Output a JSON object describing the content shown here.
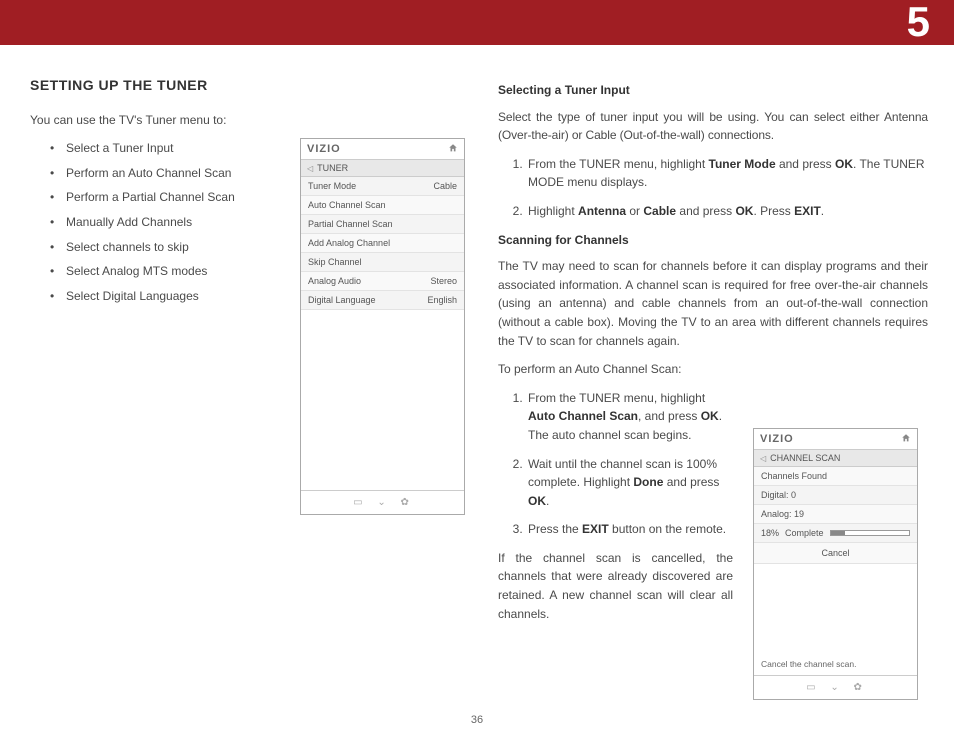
{
  "chapter": "5",
  "pageNumber": "36",
  "left": {
    "title": "SETTING UP THE TUNER",
    "intro": "You can use the TV's Tuner menu to:",
    "bullets": [
      "Select a Tuner Input",
      "Perform an Auto Channel Scan",
      "Perform a Partial Channel Scan",
      "Manually Add Channels",
      "Select channels to skip",
      "Select Analog MTS modes",
      "Select Digital Languages"
    ]
  },
  "osdTuner": {
    "logo": "VIZIO",
    "crumb": "TUNER",
    "rows": [
      {
        "label": "Tuner Mode",
        "value": "Cable"
      },
      {
        "label": "Auto Channel Scan",
        "value": ""
      },
      {
        "label": "Partial Channel Scan",
        "value": ""
      },
      {
        "label": "Add Analog Channel",
        "value": ""
      },
      {
        "label": "Skip Channel",
        "value": ""
      },
      {
        "label": "Analog Audio",
        "value": "Stereo"
      },
      {
        "label": "Digital Language",
        "value": "English"
      }
    ]
  },
  "right": {
    "h1": "Selecting a Tuner Input",
    "p1": "Select the type of tuner input you will be using. You can select either Antenna (Over-the-air) or Cable (Out-of-the-wall) connections.",
    "s1a": "From the TUNER menu, highlight ",
    "s1b": "Tuner Mode",
    "s1c": " and press ",
    "s1d": "OK",
    "s1e": ". The TUNER MODE menu displays.",
    "s2a": "Highlight ",
    "s2b": "Antenna",
    "s2c": " or ",
    "s2d": "Cable",
    "s2e": " and press ",
    "s2f": "OK",
    "s2g": ". Press ",
    "s2h": "EXIT",
    "s2i": ".",
    "h2": "Scanning for Channels",
    "p2": "The TV may need to scan for channels before it can display programs and their associated information. A channel scan is required for free over-the-air channels (using an antenna) and cable channels from an out-of-the-wall connection (without a cable box). Moving the TV to an area with different channels requires the TV to scan for channels again.",
    "p3": "To perform an Auto Channel Scan:",
    "st1a": "From the TUNER menu, highlight ",
    "st1b": "Auto Channel Scan",
    "st1c": ", and press ",
    "st1d": "OK",
    "st1e": ". The auto channel scan begins.",
    "st2a": "Wait until the channel scan is 100% complete. Highlight ",
    "st2b": "Done",
    "st2c": " and press ",
    "st2d": "OK",
    "st2e": ".",
    "st3a": "Press the ",
    "st3b": "EXIT",
    "st3c": " button on the remote.",
    "p4": "If the channel scan is cancelled, the channels that were already discovered are retained. A new channel scan will clear all channels."
  },
  "osdScan": {
    "logo": "VIZIO",
    "crumb": "CHANNEL SCAN",
    "found": "Channels Found",
    "digital": "Digital:   0",
    "analog": "Analog: 19",
    "pct": "18%",
    "complete": "Complete",
    "cancel": "Cancel",
    "help": "Cancel the channel scan."
  }
}
